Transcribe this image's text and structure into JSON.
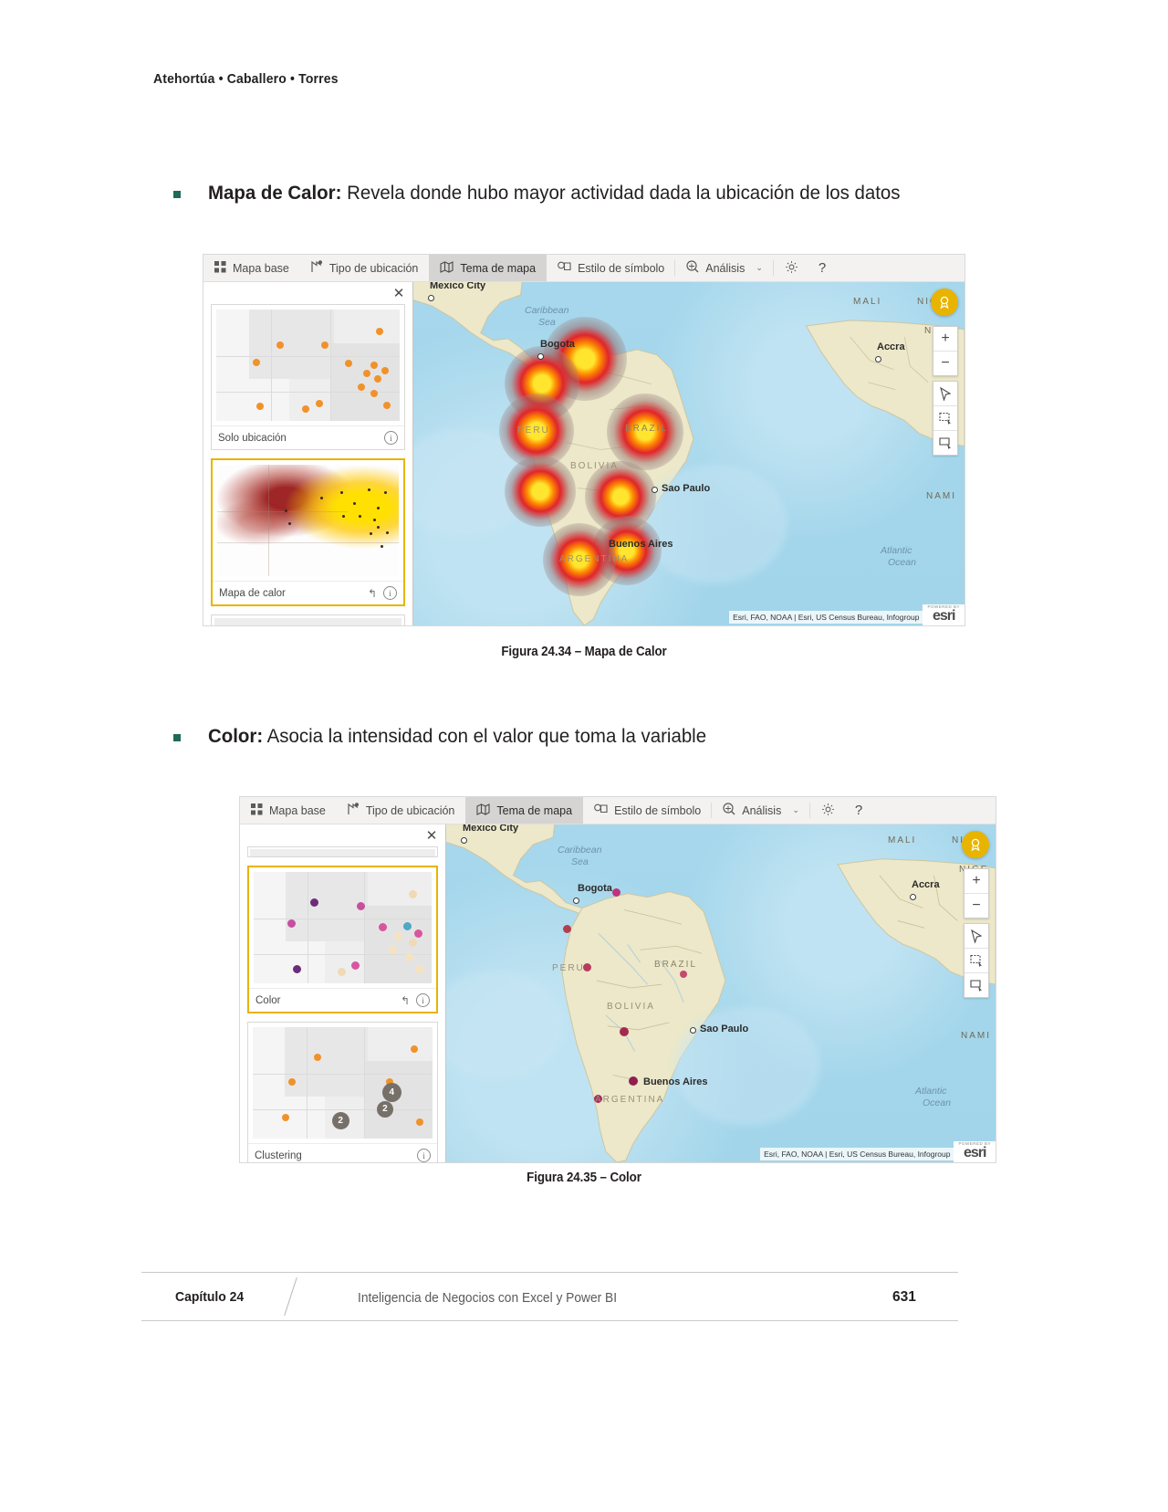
{
  "document": {
    "running_head": "Atehortúa • Caballero • Torres",
    "footer": {
      "chapter": "Capítulo 24",
      "title": "Inteligencia de Negocios con Excel y Power BI",
      "page_number": "631"
    }
  },
  "bullets": [
    {
      "label": "Mapa de Calor:",
      "text": " Revela donde hubo mayor actividad dada la ubicación de los datos"
    },
    {
      "label": "Color:",
      "text": " Asocia la intensidad con el valor que toma la variable"
    }
  ],
  "figures": [
    {
      "caption": "Figura 24.34 – Mapa de Calor"
    },
    {
      "caption": "Figura 24.35 – Color"
    }
  ],
  "toolbar": {
    "tabs": [
      {
        "label": "Mapa base",
        "icon": "grid-icon",
        "active": false
      },
      {
        "label": "Tipo de ubicación",
        "icon": "pin-icon",
        "active": false
      },
      {
        "label": "Tema de mapa",
        "icon": "map-icon",
        "active": true
      },
      {
        "label": "Estilo de símbolo",
        "icon": "symbol-icon",
        "active": false
      },
      {
        "label": "Análisis",
        "icon": "analysis-icon",
        "active": false
      }
    ],
    "analysis_chevron": "⌄",
    "settings_icon": "gear-icon",
    "help_label": "?"
  },
  "panel_heat": {
    "close_label": "✕",
    "thumbnails": [
      {
        "label": "Solo ubicación",
        "selected": false,
        "has_reset": false,
        "info": "i"
      },
      {
        "label": "Mapa de calor",
        "selected": true,
        "has_reset": true,
        "reset": "↰",
        "info": "i"
      }
    ]
  },
  "panel_color": {
    "close_label": "✕",
    "thumbnails": [
      {
        "label": "Color",
        "selected": true,
        "has_reset": true,
        "reset": "↰",
        "info": "i"
      },
      {
        "label": "Clustering",
        "selected": false,
        "has_reset": false,
        "info": "i"
      }
    ],
    "cluster_counts": [
      "4",
      "2",
      "2"
    ]
  },
  "map": {
    "labels": {
      "mexico_city": "Mexico City",
      "caribbean_sea": "Caribbean",
      "caribbean_sea2": "Sea",
      "bogota": "Bogota",
      "peru": "PERU",
      "bolivia": "BOLIVIA",
      "brazil": "BRAZIL",
      "sao_paulo": "Sao Paulo",
      "buenos_aires": "Buenos Aires",
      "argentina": "ARGENTINA",
      "atlantic": "Atlantic",
      "ocean": "Ocean",
      "mali": "MALI",
      "niger": "NIG",
      "niger2": "NIGE",
      "accra": "Accra",
      "namibia": "NAMI"
    },
    "attribution": "Esri, FAO, NOAA | Esri, US Census Bureau, Infogroup",
    "esri_powered": "POWERED BY",
    "esri_word": "esri",
    "controls": {
      "zoom_in": "+",
      "zoom_out": "−",
      "pointer": "⌕",
      "select_rect": "▱",
      "select_lasso": "▱"
    },
    "legend_badge": "legend-icon"
  },
  "colors": {
    "bullet_mark": "#1e6b5a",
    "selected_border": "#e8b400",
    "toolbar_bg": "#f3f2f1",
    "active_tab_bg": "#d6d4d2",
    "ocean": "#a6d7ec",
    "land": "#ece8c9",
    "heat_core": "#ffeb3b",
    "heat_mid": "#f44336",
    "point_orange": "#f0922b"
  }
}
